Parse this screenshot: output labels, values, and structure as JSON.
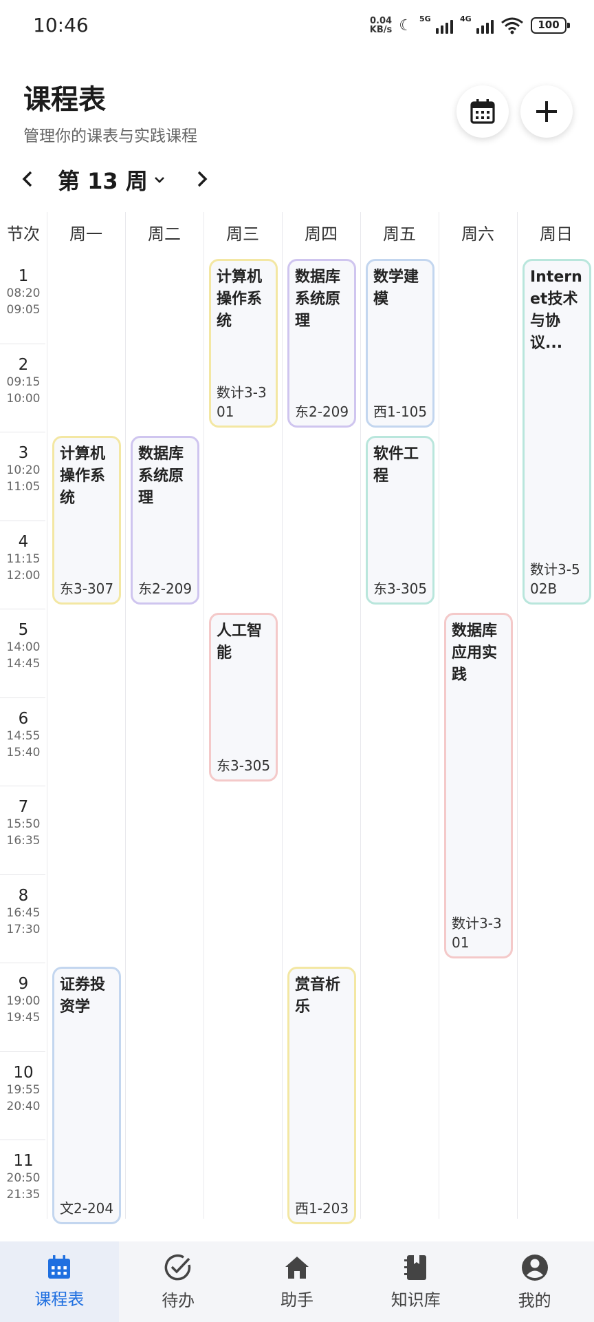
{
  "status_bar": {
    "time": "10:46",
    "net_speed_value": "0.04",
    "net_speed_unit": "KB/s",
    "signal1_label": "5G",
    "signal2_label": "4G",
    "battery": "100"
  },
  "header": {
    "title": "课程表",
    "subtitle": "管理你的课表与实践课程"
  },
  "week": {
    "label": "第 13 周"
  },
  "grid": {
    "corner_label": "节次",
    "days": [
      "周一",
      "周二",
      "周三",
      "周四",
      "周五",
      "周六",
      "周日"
    ],
    "periods": [
      {
        "num": "1",
        "start": "08:20",
        "end": "09:05"
      },
      {
        "num": "2",
        "start": "09:15",
        "end": "10:00"
      },
      {
        "num": "3",
        "start": "10:20",
        "end": "11:05"
      },
      {
        "num": "4",
        "start": "11:15",
        "end": "12:00"
      },
      {
        "num": "5",
        "start": "14:00",
        "end": "14:45"
      },
      {
        "num": "6",
        "start": "14:55",
        "end": "15:40"
      },
      {
        "num": "7",
        "start": "15:50",
        "end": "16:35"
      },
      {
        "num": "8",
        "start": "16:45",
        "end": "17:30"
      },
      {
        "num": "9",
        "start": "19:00",
        "end": "19:45"
      },
      {
        "num": "10",
        "start": "19:55",
        "end": "20:40"
      },
      {
        "num": "11",
        "start": "20:50",
        "end": "21:35"
      }
    ]
  },
  "courses": [
    {
      "name": "计算机操作系统",
      "room": "数计3-301",
      "day": 3,
      "start": 1,
      "end": 2,
      "color": "#f3e7a3"
    },
    {
      "name": "数据库系统原理",
      "room": "东2-209",
      "day": 4,
      "start": 1,
      "end": 2,
      "color": "#cfc5ef"
    },
    {
      "name": "数学建模",
      "room": "西1-105",
      "day": 5,
      "start": 1,
      "end": 2,
      "color": "#c3d6ef"
    },
    {
      "name": "Internet技术与协议...",
      "room": "数计3-502B",
      "day": 7,
      "start": 1,
      "end": 4,
      "color": "#b9e6dc"
    },
    {
      "name": "计算机操作系统",
      "room": "东3-307",
      "day": 1,
      "start": 3,
      "end": 4,
      "color": "#f3e7a3"
    },
    {
      "name": "数据库系统原理",
      "room": "东2-209",
      "day": 2,
      "start": 3,
      "end": 4,
      "color": "#cfc5ef"
    },
    {
      "name": "软件工程",
      "room": "东3-305",
      "day": 5,
      "start": 3,
      "end": 4,
      "color": "#b9e6dc"
    },
    {
      "name": "人工智能",
      "room": "东3-305",
      "day": 3,
      "start": 5,
      "end": 6,
      "color": "#f4c9c9"
    },
    {
      "name": "数据库应用实践",
      "room": "数计3-301",
      "day": 6,
      "start": 5,
      "end": 8,
      "color": "#f4c9c9"
    },
    {
      "name": "证券投资学",
      "room": "文2-204",
      "day": 1,
      "start": 9,
      "end": 11,
      "color": "#c3d6ef"
    },
    {
      "name": "赏音析乐",
      "room": "西1-203",
      "day": 4,
      "start": 9,
      "end": 11,
      "color": "#f3e7a3"
    }
  ],
  "bottom_nav": {
    "items": [
      {
        "label": "课程表",
        "icon": "calendar-icon",
        "active": true
      },
      {
        "label": "待办",
        "icon": "check-circle-icon",
        "active": false
      },
      {
        "label": "助手",
        "icon": "home-icon",
        "active": false
      },
      {
        "label": "知识库",
        "icon": "notebook-icon",
        "active": false
      },
      {
        "label": "我的",
        "icon": "profile-icon",
        "active": false
      }
    ]
  },
  "colors": {
    "accent": "#1f6fe0",
    "yellow": "#f3e7a3",
    "purple": "#cfc5ef",
    "blue": "#c3d6ef",
    "teal": "#b9e6dc",
    "pink": "#f4c9c9"
  }
}
